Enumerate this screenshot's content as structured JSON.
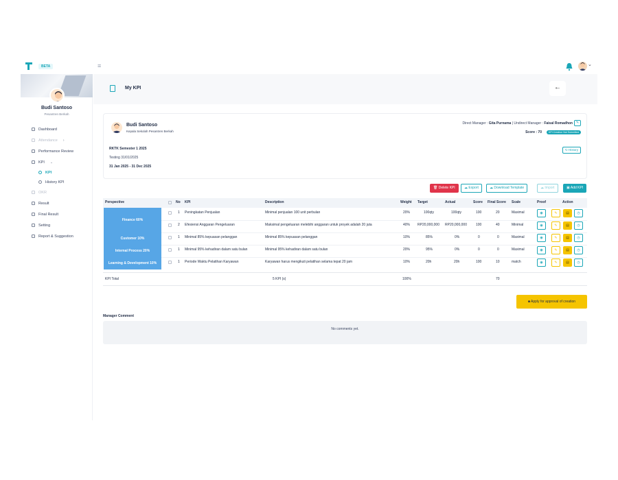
{
  "brand": {
    "label": "BETA"
  },
  "sidebar": {
    "user_name": "Budi Santoso",
    "user_org": "Pesantren Berkah",
    "items": [
      {
        "label": "Dashboard",
        "state": "normal"
      },
      {
        "label": "Attendance",
        "state": "disabled"
      },
      {
        "label": "Performance Review",
        "state": "normal"
      },
      {
        "label": "KPI",
        "state": "normal"
      },
      {
        "label": "KPI",
        "state": "active-sub"
      },
      {
        "label": "History KPI",
        "state": "sub"
      },
      {
        "label": "OKR",
        "state": "disabled"
      },
      {
        "label": "Result",
        "state": "normal"
      },
      {
        "label": "Final Result",
        "state": "normal"
      },
      {
        "label": "Setting",
        "state": "normal"
      },
      {
        "label": "Report & Suggestion",
        "state": "normal"
      }
    ]
  },
  "header": {
    "title": "My KPI",
    "back_icon": "arrow-left-icon"
  },
  "employee": {
    "name": "Budi Santoso",
    "role": "Kepala Sekolah Pesantren Berkah",
    "direct_manager_label": "Direct Manager :",
    "direct_manager": "Gita Purnama",
    "indirect_manager_label": "| Undirect Manager :",
    "indirect_manager": "Faisal Romadhon",
    "score_label": "Score : 70",
    "status": "KPI Creation Not Submitted",
    "period_title": "RKTK Semester 1 2025",
    "period_sub": "Testing 31/01/2025",
    "period_range": "31 Jan 2025 - 31 Dec 2025",
    "history_label": "History"
  },
  "actions": {
    "delete": "Delete KPI",
    "export": "Export",
    "download": "Download Template",
    "import": "Import",
    "add": "Add KPI"
  },
  "table": {
    "headers": {
      "perspective": "Perspective",
      "no": "No",
      "kpi": "KPI",
      "description": "Description",
      "weight": "Weight",
      "target": "Target",
      "actual": "Actual",
      "score": "Score",
      "final_score": "Final Score",
      "scale": "Scale",
      "proof": "Proof",
      "action": "Action"
    },
    "perspectives": [
      {
        "label": "Finance 60%"
      },
      {
        "label": "Customer 10%"
      },
      {
        "label": "Internal Process 20%"
      },
      {
        "label": "Learning & Development 10%"
      }
    ],
    "rows": [
      {
        "no": "1",
        "kpi": "Peningkatan Penjualan",
        "description": "Minimal penjualan 100 unit perbulan",
        "weight": "20%",
        "target": "100qty",
        "actual": "100qty",
        "score": "100",
        "final_score": "20",
        "scale": "Maximal"
      },
      {
        "no": "2",
        "kpi": "Efesiensi Anggaran Pengeluaran",
        "description": "Maksimal pengeluaran melebihi anggaran untuk proyek adalah 20 juta",
        "weight": "40%",
        "target": "RP20,000,000",
        "actual": "RP20,000,000",
        "score": "100",
        "final_score": "40",
        "scale": "Minimal"
      },
      {
        "no": "1",
        "kpi": "Minimal 85% kepuasan pelanggan",
        "description": "Minimal 85% kepuasan pelanggan",
        "weight": "10%",
        "target": "85%",
        "actual": "0%",
        "score": "0",
        "final_score": "0",
        "scale": "Maximal"
      },
      {
        "no": "1",
        "kpi": "Minimal 95% kehadiran dalam satu bulan",
        "description": "Minimal 95% kehadiran dalam satu bulan",
        "weight": "20%",
        "target": "95%",
        "actual": "0%",
        "score": "0",
        "final_score": "0",
        "scale": "Maximal"
      },
      {
        "no": "1",
        "kpi": "Periode Waktu Pelatihan Karyawan",
        "description": "Karyawan harus mengikuti pelatihan selama tepat 20 jam",
        "weight": "10%",
        "target": "20h",
        "actual": "20h",
        "score": "100",
        "final_score": "10",
        "scale": "match"
      }
    ],
    "total": {
      "label": "KPI Total",
      "count": "5 KPI (s)",
      "weight": "100%",
      "final_score": "70"
    }
  },
  "apply_label": "Apply for approval of creation",
  "comment": {
    "title": "Manager Comment",
    "empty": "No comments yet."
  },
  "colors": {
    "accent": "#1aa6b7",
    "perspective": "#57a6e6",
    "warning": "#f5c400",
    "danger": "#e0344a"
  }
}
